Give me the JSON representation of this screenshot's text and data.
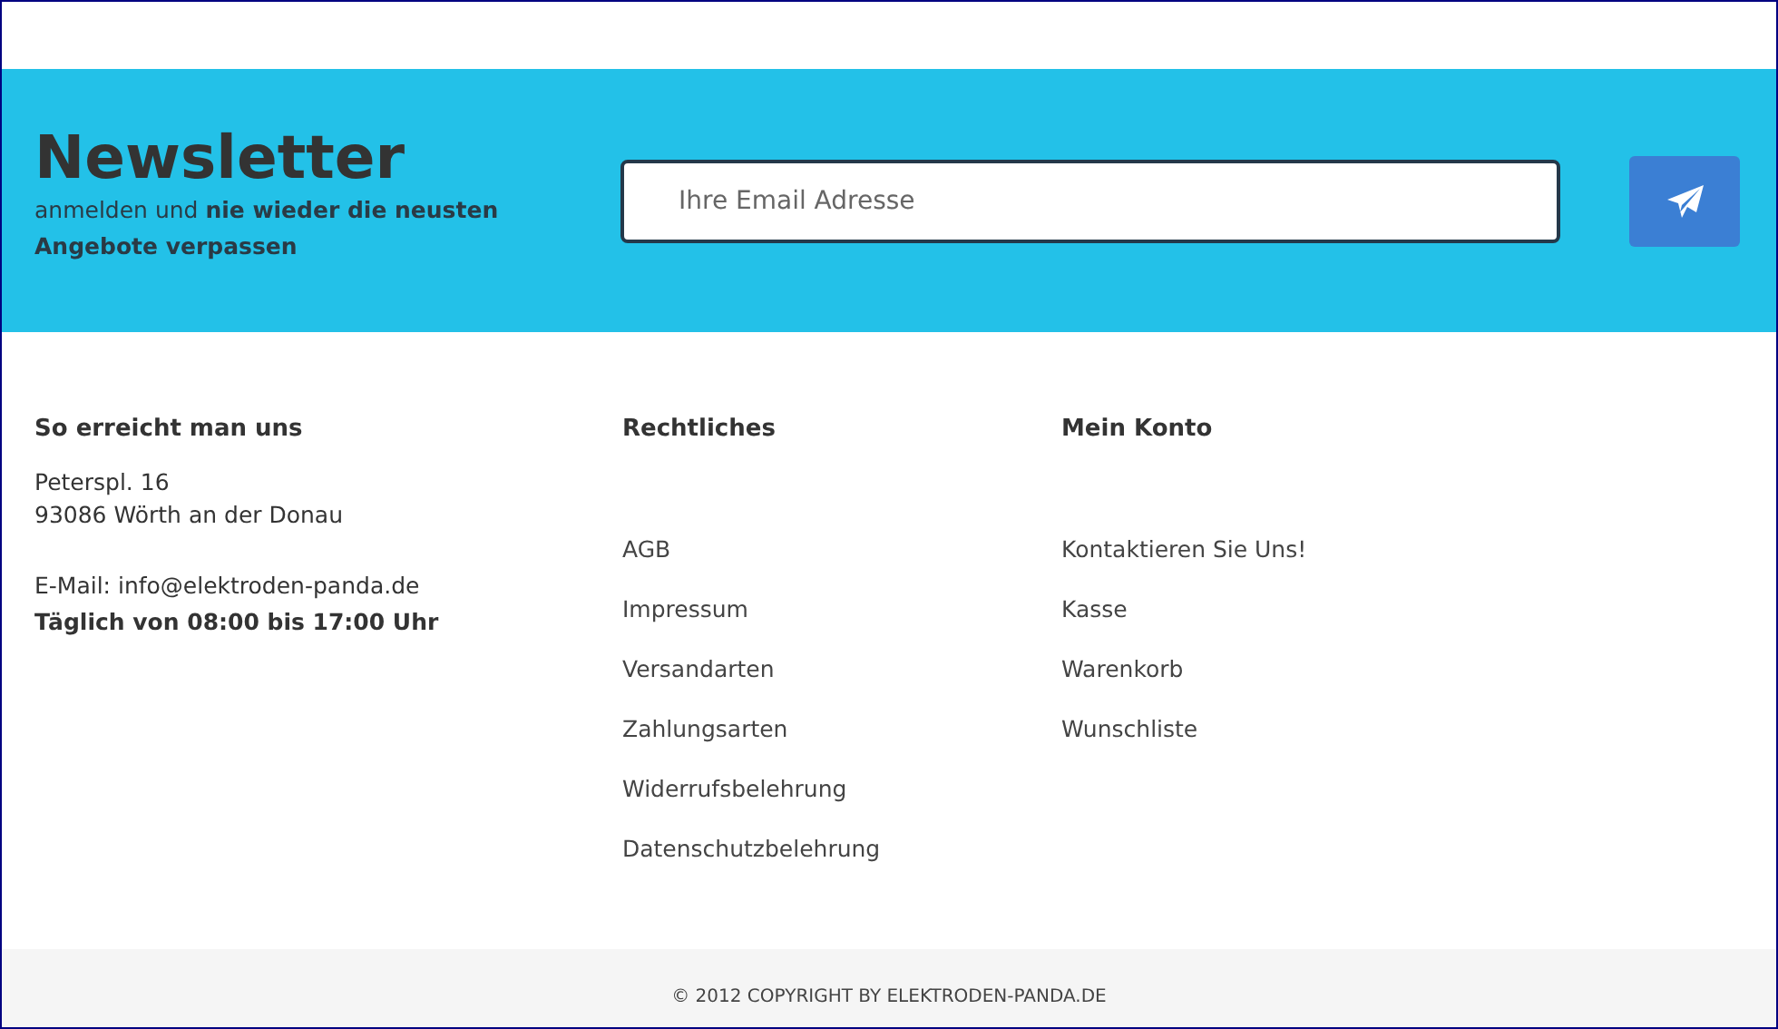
{
  "newsletter": {
    "title": "Newsletter",
    "subtitle": "anmelden und **nie wieder die neusten Angebote verpassen**",
    "email_field": {
      "placeholder": "Ihre Email Adresse"
    }
  },
  "contact": {
    "heading": "So erreicht man uns",
    "address_lines": [
      "Peterspl. 16",
      "93086 Wörth an der Donau"
    ],
    "email": "E-Mail: info@elektroden-panda.de",
    "hours": "Täglich von 08:00 bis 17:00 Uhr"
  },
  "link_columns": [
    {
      "heading": "Rechtliches",
      "links": [
        "AGB",
        "Impressum",
        "Versandarten",
        "Zahlungsarten",
        "Widerrufsbelehrung",
        "Datenschutzbelehrung"
      ]
    },
    {
      "heading": "Mein Konto",
      "links": [
        "Kontaktieren Sie Uns!",
        "Kasse",
        "Warenkorb",
        "Wunschliste"
      ]
    }
  ],
  "copyright": "© 2012 COPYRIGHT BY ELEKTRODEN-PANDA.DE"
}
